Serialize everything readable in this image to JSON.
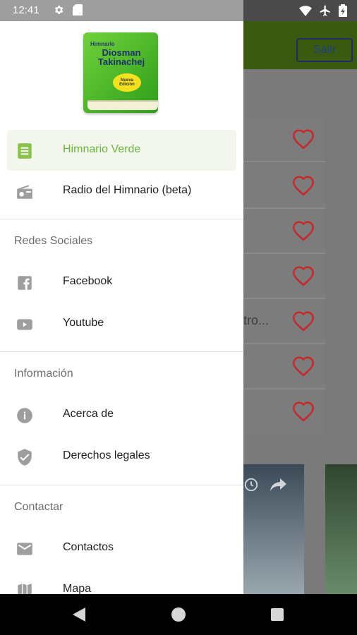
{
  "status_bar": {
    "time": "12:41",
    "icons": [
      "gear-icon",
      "sd-card-icon",
      "wifi-icon",
      "airplane-icon",
      "battery-icon"
    ]
  },
  "background_app": {
    "exit_button_label": "Salir",
    "row_fragments": [
      "",
      "",
      "",
      "",
      "tro...",
      "",
      ""
    ],
    "accent_heart": "#d32f2f"
  },
  "drawer": {
    "logo": {
      "small_text": "Himnario",
      "title": "Diosman Takinachej",
      "badge": "Nueva Edición"
    },
    "main_items": [
      {
        "label": "Himnario Verde",
        "icon": "book-icon",
        "active": true
      },
      {
        "label": "Radio del Himnario (beta)",
        "icon": "radio-icon",
        "active": false
      }
    ],
    "sections": [
      {
        "title": "Redes Sociales",
        "items": [
          {
            "label": "Facebook",
            "icon": "facebook-icon"
          },
          {
            "label": "Youtube",
            "icon": "youtube-icon"
          }
        ]
      },
      {
        "title": "Información",
        "items": [
          {
            "label": "Acerca de",
            "icon": "info-icon"
          },
          {
            "label": "Derechos legales",
            "icon": "shield-check-icon"
          }
        ]
      },
      {
        "title": "Contactar",
        "items": [
          {
            "label": "Contactos",
            "icon": "mail-icon"
          },
          {
            "label": "Mapa",
            "icon": "map-icon"
          }
        ]
      }
    ],
    "active_color": "#6ab53a"
  },
  "nav_bar": {
    "buttons": [
      "back-icon",
      "home-icon",
      "recents-icon"
    ]
  }
}
